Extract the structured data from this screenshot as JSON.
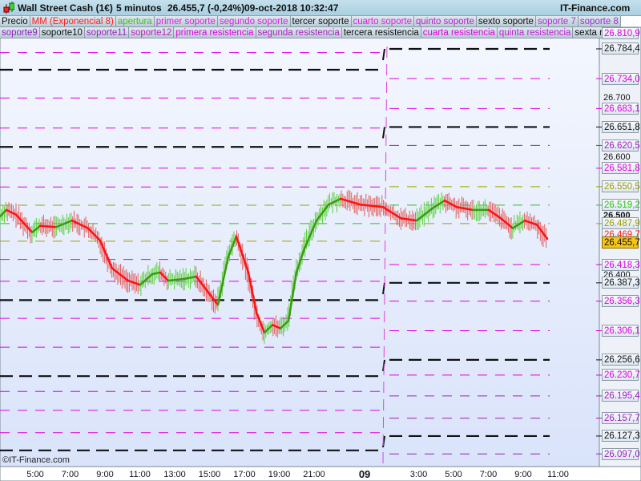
{
  "title": {
    "instrument": "Wall Street Cash (1€)",
    "timeframe": "5 minutos",
    "price": "26.455,7 (-0,24%)",
    "datetime": "09-oct-2018 10:32:47",
    "brand": "IT-Finance.com"
  },
  "legend_row1": [
    {
      "label": "Precio",
      "color": "#111111"
    },
    {
      "label": "MM (Exponencial 8)",
      "color": "#ff2020"
    },
    {
      "label": "apertura",
      "color": "#40c020"
    },
    {
      "label": "primer soporte",
      "color": "#e020e0"
    },
    {
      "label": "segundo soporte",
      "color": "#e020e0"
    },
    {
      "label": "tercer soporte",
      "color": "#111111"
    },
    {
      "label": "cuarto soporte",
      "color": "#e020e0"
    },
    {
      "label": "quinto soporte",
      "color": "#c020d0"
    },
    {
      "label": "sexto soporte",
      "color": "#111111"
    },
    {
      "label": "soporte 7",
      "color": "#b030d0"
    },
    {
      "label": "soporte 8",
      "color": "#a030d0"
    }
  ],
  "legend_row2": [
    {
      "label": "soporte9",
      "color": "#9020c0"
    },
    {
      "label": "soporte10",
      "color": "#111111"
    },
    {
      "label": "soporte11",
      "color": "#a020c0"
    },
    {
      "label": "soporte12",
      "color": "#c020c0"
    },
    {
      "label": "primera resistencia",
      "color": "#e000e0"
    },
    {
      "label": "segunda resistencia",
      "color": "#b020c0"
    },
    {
      "label": "tercera resistencia",
      "color": "#111111"
    },
    {
      "label": "cuarta resistencia",
      "color": "#e000e0"
    },
    {
      "label": "quinta resistencia",
      "color": "#c020d0"
    },
    {
      "label": "sexta resist",
      "color": "#111111"
    }
  ],
  "price_axis_ticks": [
    {
      "label": "26.700",
      "price": 26700,
      "bold": false
    },
    {
      "label": "26.600",
      "price": 26600,
      "bold": false
    },
    {
      "label": "26.500",
      "price": 26500,
      "bold": true
    },
    {
      "label": "26.400",
      "price": 26400,
      "bold": false
    }
  ],
  "right_levels": [
    {
      "label": "26.810,9",
      "price": 26810.9,
      "color": "#e000e0"
    },
    {
      "label": "26.784,4",
      "price": 26784.4,
      "color": "#111111"
    },
    {
      "label": "26.734,0",
      "price": 26734.0,
      "color": "#e000e0"
    },
    {
      "label": "26.683,1",
      "price": 26683.1,
      "color": "#e000e0"
    },
    {
      "label": "26.651,8",
      "price": 26651.8,
      "color": "#111111"
    },
    {
      "label": "26.620,5",
      "price": 26620.5,
      "color": "#a020c0"
    },
    {
      "label": "26.581,8",
      "price": 26581.8,
      "color": "#e000e0"
    },
    {
      "label": "26.550,5",
      "price": 26550.5,
      "color": "#a0a000"
    },
    {
      "label": "26.519,2",
      "price": 26519.2,
      "color": "#30c010"
    },
    {
      "label": "26.487,9",
      "price": 26487.9,
      "color": "#a0a000"
    },
    {
      "label": "26.418,3",
      "price": 26418.3,
      "color": "#e000e0"
    },
    {
      "label": "26.387,3",
      "price": 26387.3,
      "color": "#111111"
    },
    {
      "label": "26.356,3",
      "price": 26356.3,
      "color": "#e000e0"
    },
    {
      "label": "26.306,1",
      "price": 26306.1,
      "color": "#e000e0"
    },
    {
      "label": "26.256,6",
      "price": 26256.6,
      "color": "#111111"
    },
    {
      "label": "26.230,7",
      "price": 26230.7,
      "color": "#e000e0"
    },
    {
      "label": "26.195,4",
      "price": 26195.4,
      "color": "#a020c0"
    },
    {
      "label": "26.157,7",
      "price": 26157.7,
      "color": "#a020c0"
    },
    {
      "label": "26.127,3",
      "price": 26127.3,
      "color": "#111111"
    },
    {
      "label": "26.097,0",
      "price": 26097.0,
      "color": "#a020c0"
    }
  ],
  "ema_label": {
    "label": "26.469,7",
    "price": 26469.7,
    "color": "#ff2020"
  },
  "current_price": {
    "label": "26.455,7",
    "price": 26455.7
  },
  "left_levels": [
    {
      "price": 26778,
      "color": "#e000e0"
    },
    {
      "price": 26749,
      "color": "#111111"
    },
    {
      "price": 26701,
      "color": "#e000e0"
    },
    {
      "price": 26650,
      "color": "#e000e0"
    },
    {
      "price": 26618,
      "color": "#111111"
    },
    {
      "price": 26582,
      "color": "#e000e0"
    },
    {
      "price": 26550,
      "color": "#e000e0"
    },
    {
      "price": 26519,
      "color": "#a0a000"
    },
    {
      "price": 26488,
      "color": "#30c010"
    },
    {
      "price": 26458,
      "color": "#a0a000"
    },
    {
      "price": 26427,
      "color": "#e000e0"
    },
    {
      "price": 26390,
      "color": "#e000e0"
    },
    {
      "price": 26358,
      "color": "#111111"
    },
    {
      "price": 26327,
      "color": "#e000e0"
    },
    {
      "price": 26278,
      "color": "#e000e0"
    },
    {
      "price": 26229,
      "color": "#111111"
    },
    {
      "price": 26203,
      "color": "#e000e0"
    },
    {
      "price": 26171,
      "color": "#e000e0"
    },
    {
      "price": 26133,
      "color": "#e000e0"
    },
    {
      "price": 26103,
      "color": "#111111"
    }
  ],
  "x_axis": [
    {
      "label": "5:00",
      "t": 5
    },
    {
      "label": "7:00",
      "t": 7
    },
    {
      "label": "9:00",
      "t": 9
    },
    {
      "label": "11:00",
      "t": 11
    },
    {
      "label": "13:00",
      "t": 13
    },
    {
      "label": "15:00",
      "t": 15
    },
    {
      "label": "17:00",
      "t": 17
    },
    {
      "label": "19:00",
      "t": 19
    },
    {
      "label": "21:00",
      "t": 21
    },
    {
      "label": "09",
      "t": 23.9,
      "bold": true
    },
    {
      "label": "3:00",
      "t": 27
    },
    {
      "label": "5:00",
      "t": 29
    },
    {
      "label": "7:00",
      "t": 31
    },
    {
      "label": "9:00",
      "t": 33
    },
    {
      "label": "11:00",
      "t": 35
    }
  ],
  "copyright": "©IT-Finance.com",
  "chart_data": {
    "type": "line",
    "series": [
      {
        "name": "MM (Exponencial 8)",
        "t_hours": [
          2.98,
          3.34,
          3.9,
          4.82,
          5.28,
          6.2,
          7.11,
          8.03,
          8.72,
          9.41,
          10.33,
          11.02,
          11.71,
          12.17,
          12.63,
          13.55,
          14.24,
          14.93,
          15.48,
          16.08,
          16.54,
          17.23,
          17.69,
          18.15,
          18.61,
          19.07,
          19.53,
          19.99,
          20.45,
          21.14,
          21.83,
          22.52,
          23.67,
          24.95,
          25.97,
          26.89,
          27.8,
          28.49,
          29.18,
          30.1,
          31.02,
          31.71,
          32.4,
          33.09,
          33.78,
          34.38
        ],
        "values": [
          26500,
          26511,
          26503,
          26473,
          26484,
          26482,
          26493,
          26480,
          26459,
          26412,
          26391,
          26384,
          26402,
          26405,
          26391,
          26394,
          26398,
          26371,
          26350,
          26432,
          26466,
          26405,
          26337,
          26303,
          26316,
          26310,
          26323,
          26405,
          26446,
          26493,
          26520,
          26530,
          26520,
          26516,
          26497,
          26493,
          26514,
          26527,
          26516,
          26511,
          26511,
          26497,
          26480,
          26493,
          26486,
          26462
        ]
      }
    ],
    "ylim": [
      26096,
      26817
    ],
    "xlabel": "",
    "ylabel": ""
  }
}
